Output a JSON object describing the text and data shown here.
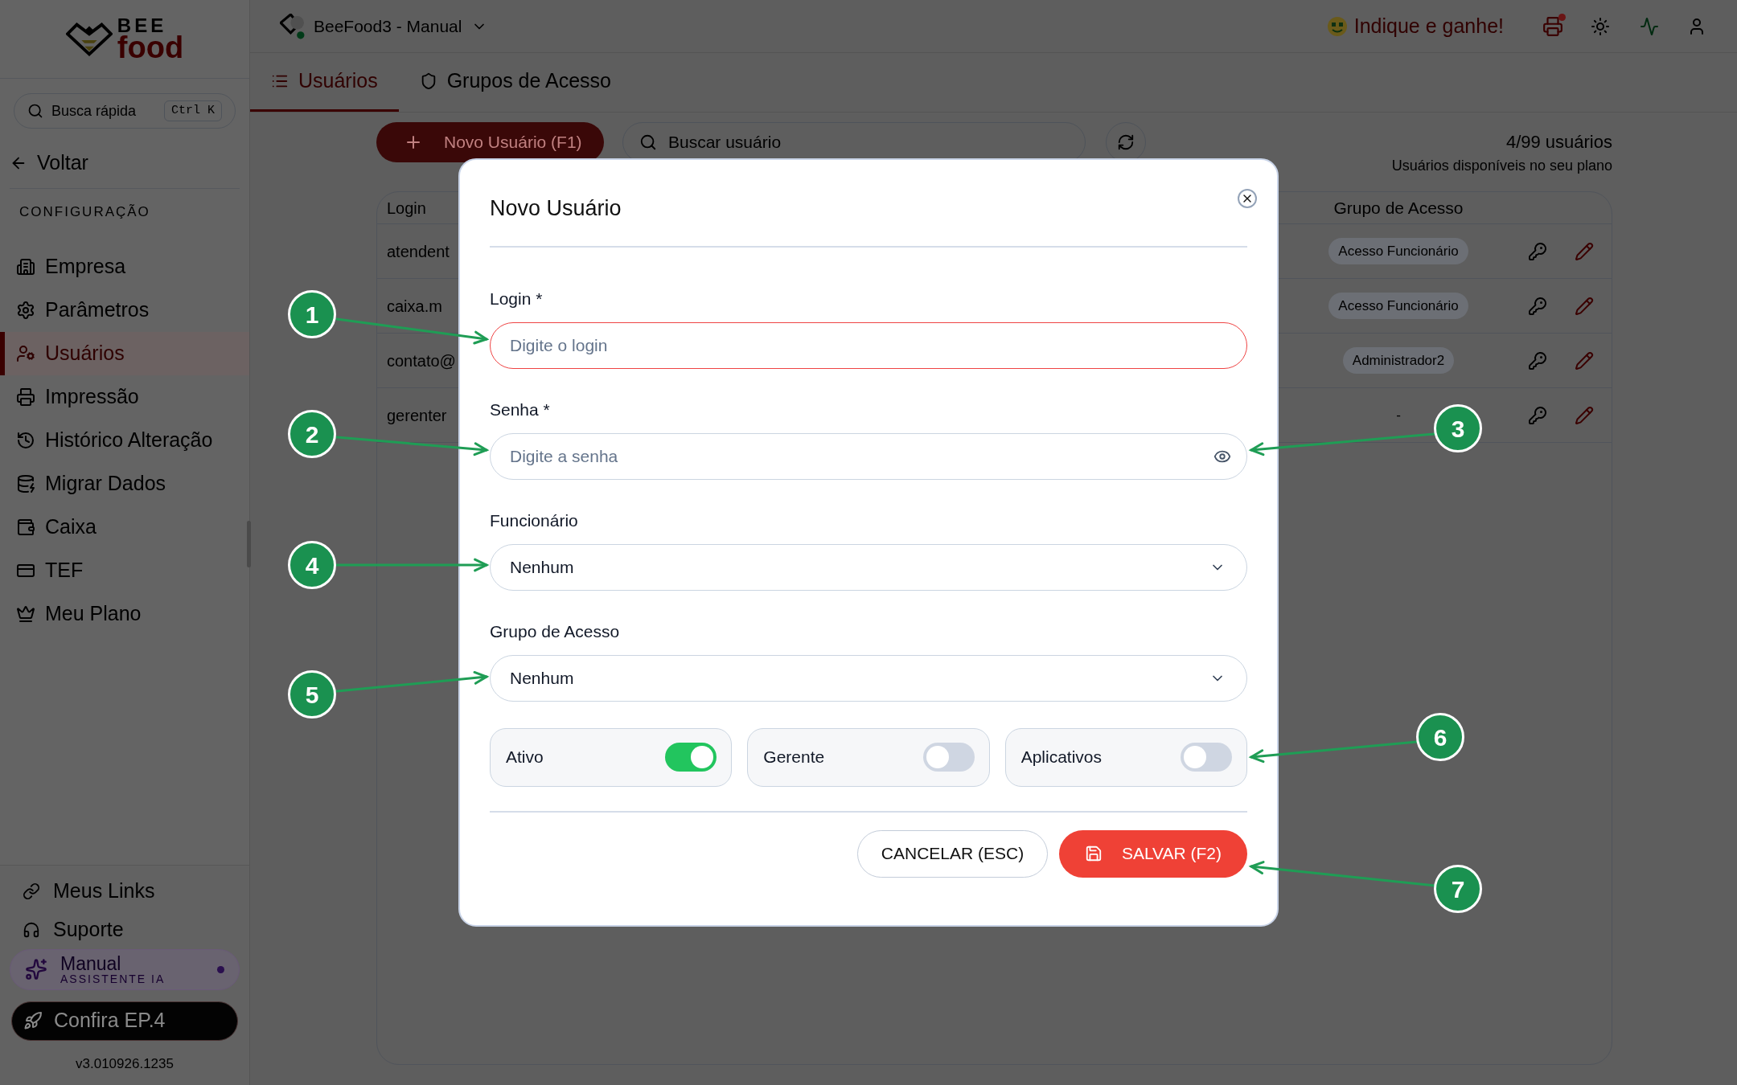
{
  "logo": {
    "top": "BEE",
    "bottom": "food"
  },
  "quick_search": {
    "placeholder": "Busca rápida",
    "shortcut": "Ctrl K"
  },
  "back": "Voltar",
  "section_title": "CONFIGURAÇÃO",
  "menu": [
    {
      "label": "Empresa",
      "selected": false
    },
    {
      "label": "Parâmetros",
      "selected": false
    },
    {
      "label": "Usuários",
      "selected": true
    },
    {
      "label": "Impressão",
      "selected": false
    },
    {
      "label": "Histórico Alteração",
      "selected": false
    },
    {
      "label": "Migrar Dados",
      "selected": false
    },
    {
      "label": "Caixa",
      "selected": false
    },
    {
      "label": "TEF",
      "selected": false
    },
    {
      "label": "Meu Plano",
      "selected": false
    }
  ],
  "footer_links": [
    {
      "label": "Meus Links"
    },
    {
      "label": "Suporte"
    }
  ],
  "assistant": {
    "title": "Manual",
    "subtitle": "ASSISTENTE IA"
  },
  "promo": "Confira EP.4",
  "version": "v3.010926.1235",
  "header": {
    "workspace": "BeeFood3 - Manual",
    "referral": "Indique e ganhe!",
    "printer_alert": true
  },
  "tabs": [
    {
      "label": "Usuários",
      "selected": true
    },
    {
      "label": "Grupos de Acesso",
      "selected": false
    }
  ],
  "toolbar": {
    "new_button": "Novo Usuário (F1)",
    "search_placeholder": "Buscar usuário",
    "count": "4/99 usuários",
    "count_hint": "Usuários disponíveis no seu plano"
  },
  "table": {
    "columns": [
      "Login",
      "Grupo de Acesso"
    ],
    "rows": [
      {
        "login": "atendent",
        "group": "Acesso Funcionário",
        "kind": "badge"
      },
      {
        "login": "caixa.m",
        "group": "Acesso Funcionário",
        "kind": "badge"
      },
      {
        "login": "contato@",
        "group": "Administrador2",
        "kind": "badge"
      },
      {
        "login": "gerenter",
        "group": "-",
        "kind": "plain"
      }
    ]
  },
  "modal": {
    "title": "Novo Usuário",
    "fields": [
      {
        "kind": "text",
        "label": "Login *",
        "placeholder": "Digite o login",
        "error": true
      },
      {
        "kind": "password",
        "label": "Senha *",
        "placeholder": "Digite a senha",
        "error": false
      },
      {
        "kind": "select",
        "label": "Funcionário",
        "value": "Nenhum",
        "error": false
      },
      {
        "kind": "select",
        "label": "Grupo de Acesso",
        "value": "Nenhum",
        "error": false
      }
    ],
    "toggles": [
      {
        "label": "Ativo",
        "on": true
      },
      {
        "label": "Gerente",
        "on": false
      },
      {
        "label": "Aplicativos",
        "on": false
      }
    ],
    "cancel": "CANCELAR (ESC)",
    "save": "SALVAR (F2)"
  },
  "callouts": [
    {
      "number": "1"
    },
    {
      "number": "2"
    },
    {
      "number": "3"
    },
    {
      "number": "4"
    },
    {
      "number": "5"
    },
    {
      "number": "6"
    },
    {
      "number": "7"
    }
  ]
}
